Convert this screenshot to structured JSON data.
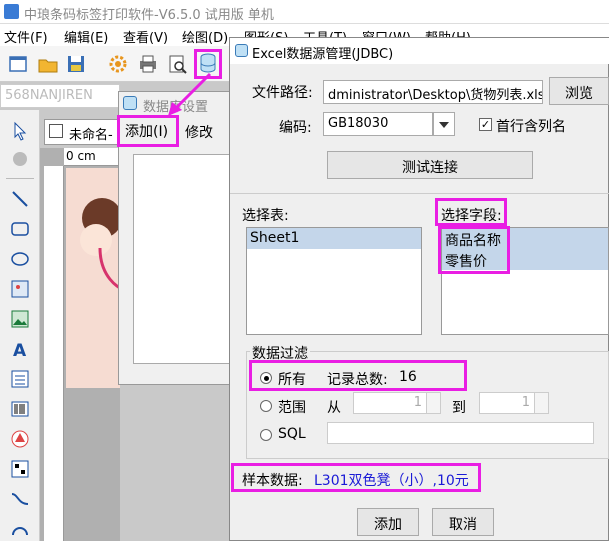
{
  "app": {
    "title": "中琅条码标签打印软件-V6.5.0 试用版 单机"
  },
  "menu": [
    "文件(F)",
    "编辑(E)",
    "查看(V)",
    "绘图(D)",
    "图形(S)",
    "工具(T)",
    "窗口(W)",
    "帮助(H)"
  ],
  "font_box": {
    "value": "568NANJIREN"
  },
  "doc_tab": {
    "label": "未命名-"
  },
  "ruler": {
    "unit_label": "0 cm"
  },
  "data_source_dialog": {
    "title": "数据库设置",
    "add_label": "添加(I)",
    "modify_label": "修改"
  },
  "excel_dialog": {
    "title": "Excel数据源管理(JDBC)",
    "file_path_label": "文件路径:",
    "file_path_value": "dministrator\\Desktop\\货物列表.xlsx",
    "browse_label": "浏览",
    "encoding_label": "编码:",
    "encoding_value": "GB18030",
    "first_row_label": "首行含列名",
    "first_row_checked": true,
    "test_button": "测试连接",
    "select_table_label": "选择表:",
    "tables": [
      "Sheet1"
    ],
    "select_field_label": "选择字段:",
    "fields": [
      "商品名称",
      "零售价"
    ],
    "filter_label": "数据过滤",
    "all_label": "所有",
    "record_total_label": "记录总数:",
    "record_total_value": "16",
    "range_label": "范围",
    "from_label": "从",
    "from_value": "1",
    "to_label": "到",
    "to_value": "1",
    "sql_label": "SQL",
    "sample_label": "样本数据:",
    "sample_value": "L301双色凳（小）,10元",
    "add_button": "添加",
    "cancel_button": "取消"
  },
  "colors": {
    "highlight": "#e91ee3",
    "sample_text": "#1a1ad6",
    "selection": "#c4d6ea"
  }
}
